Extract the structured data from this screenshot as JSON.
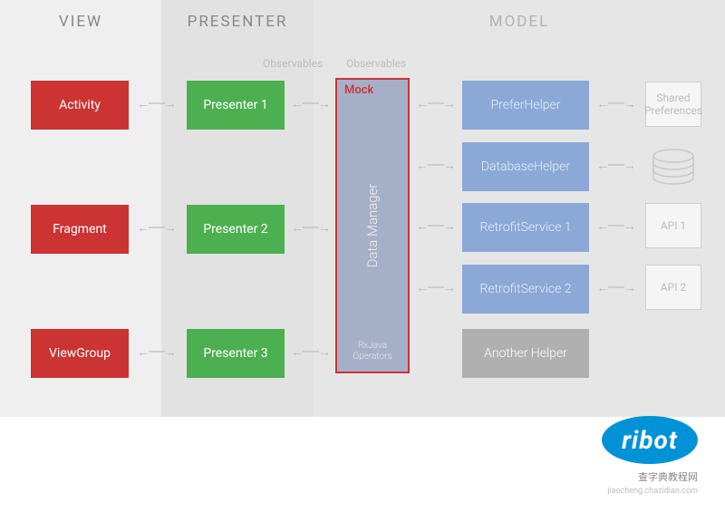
{
  "columns": {
    "view": "VIEW",
    "presenter": "PRESENTER",
    "model": "MODEL"
  },
  "labels": {
    "observables": "Observables"
  },
  "view_boxes": {
    "activity": "Activity",
    "fragment": "Fragment",
    "viewgroup": "ViewGroup"
  },
  "presenter_boxes": {
    "p1": "Presenter 1",
    "p2": "Presenter 2",
    "p3": "Presenter 3"
  },
  "data_manager": {
    "mock": "Mock",
    "title": "Data Manager",
    "subtitle1": "RxJava",
    "subtitle2": "Operators"
  },
  "model_boxes": {
    "prefer": "PreferHelper",
    "db": "DatabaseHelper",
    "r1": "RetrofitService 1",
    "r2": "RetrofitService 2",
    "another": "Another Helper"
  },
  "ext_boxes": {
    "shared1": "Shared",
    "shared2": "Preferences",
    "api1": "API 1",
    "api2": "API 2"
  },
  "brand": {
    "name": "ribot",
    "sub": "查字典教程网",
    "sub_url": "jiaocheng.chazidian.com"
  }
}
